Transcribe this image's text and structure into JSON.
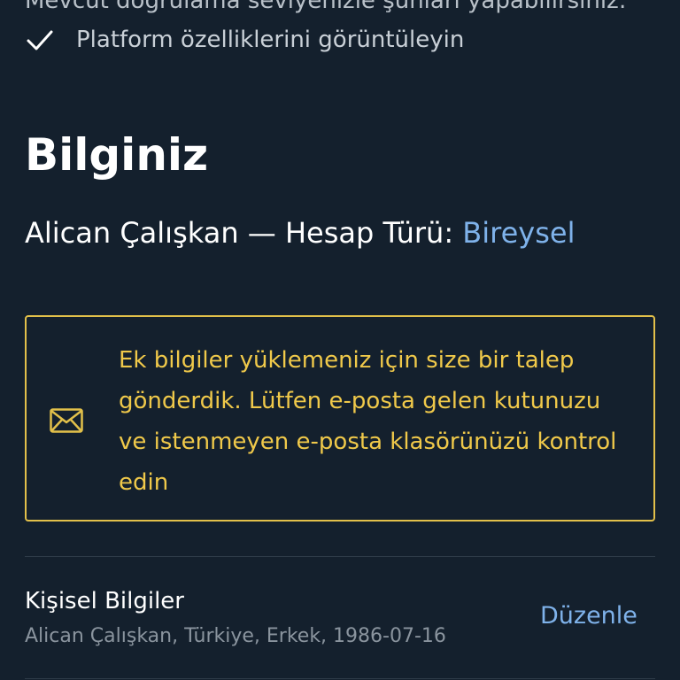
{
  "capabilities": {
    "intro": "Mevcut doğrulama seviyenizle şunları yapabilirsiniz:",
    "items": [
      {
        "label": "Platform özelliklerini görüntüleyin",
        "icon": "check-icon"
      }
    ]
  },
  "info_section": {
    "title": "Bilginiz",
    "account_name": "Alican Çalışkan — Hesap Türü: ",
    "account_type": "Bireysel"
  },
  "notice": {
    "icon": "mail-icon",
    "message": "Ek bilgiler yüklemeniz için size bir talep gönderdik. Lütfen e-posta gelen kutunuzu ve istenmeyen e-posta klasörünüzü kontrol edin"
  },
  "personal_info": {
    "title": "Kişisel Bilgiler",
    "summary": "Alican Çalışkan, Türkiye, Erkek, 1986-07-16",
    "edit_label": "Düzenle"
  },
  "colors": {
    "background": "#14202d",
    "accent_blue": "#7fb2ea",
    "warning_yellow": "#e2c04a"
  }
}
